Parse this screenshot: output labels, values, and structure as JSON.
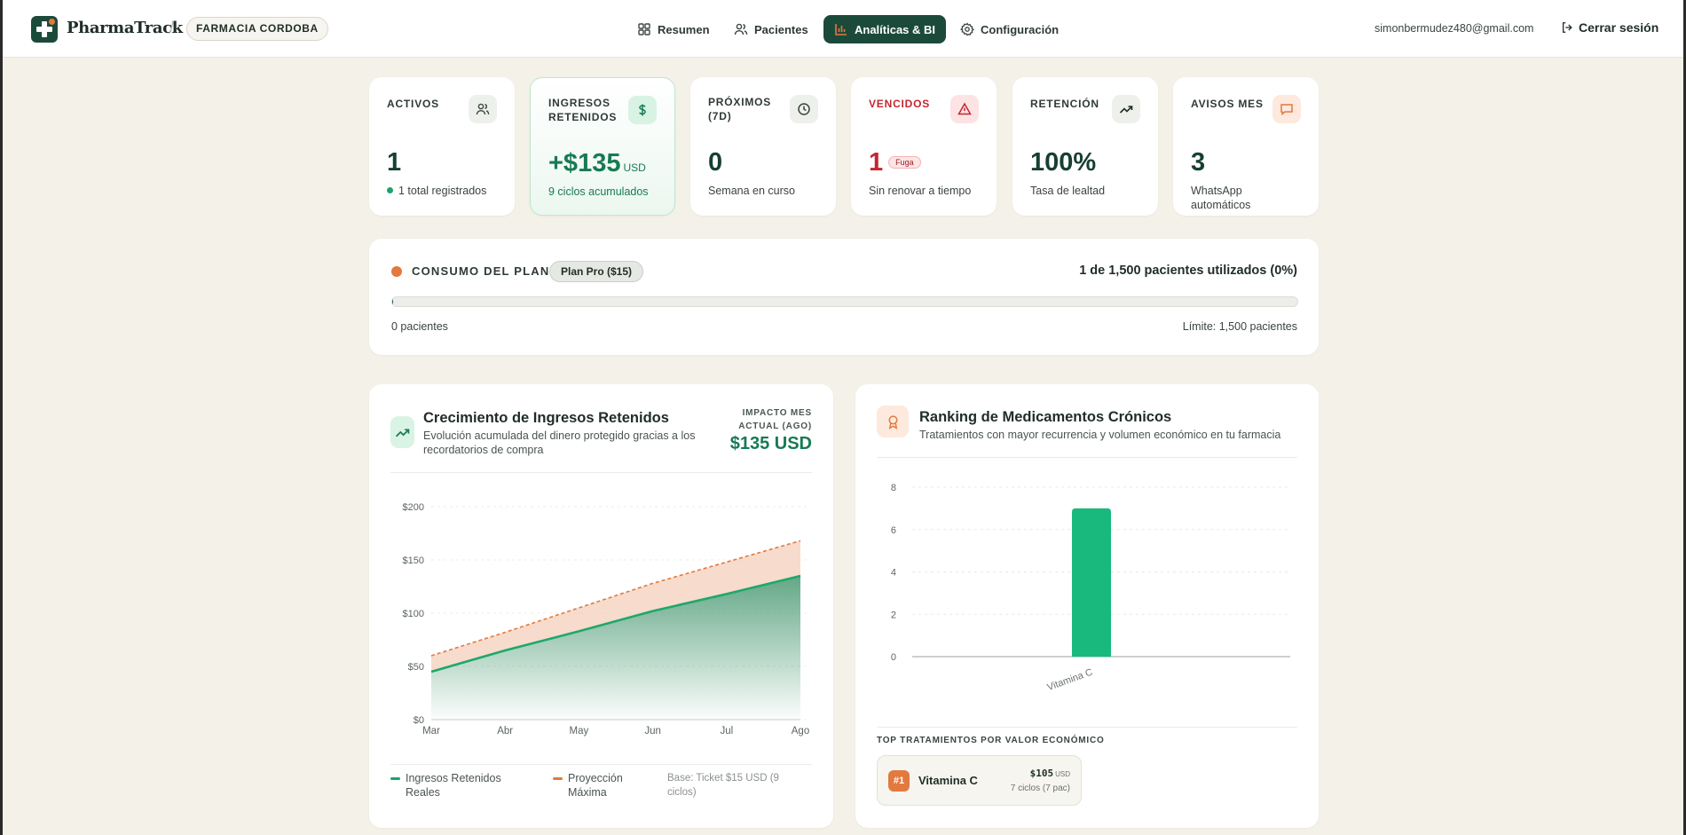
{
  "header": {
    "brand": "PharmaTrack",
    "separator": "/",
    "pharmacy": "FARMACIA CORDOBA",
    "nav": [
      {
        "label": "Resumen",
        "icon": "grid-icon"
      },
      {
        "label": "Pacientes",
        "icon": "users-icon"
      },
      {
        "label": "Analíticas & BI",
        "icon": "bar-chart-icon",
        "active": true
      },
      {
        "label": "Configuración",
        "icon": "gear-icon"
      }
    ],
    "email": "simonbermudez480@gmail.com",
    "logout": "Cerrar sesión"
  },
  "stats": [
    {
      "label": "ACTIVOS",
      "value": "1",
      "sub": "1 total registrados",
      "icon": "users-icon"
    },
    {
      "label": "INGRESOS RETENIDOS",
      "value": "+$135",
      "unit": "USD",
      "sub": "9 ciclos acumulados",
      "icon": "dollar-icon"
    },
    {
      "label": "PRÓXIMOS (7D)",
      "value": "0",
      "sub": "Semana en curso",
      "icon": "clock-icon"
    },
    {
      "label": "VENCIDOS",
      "value": "1",
      "badge": "Fuga",
      "sub": "Sin renovar a tiempo",
      "icon": "alert-triangle-icon"
    },
    {
      "label": "RETENCIÓN",
      "value": "100%",
      "sub": "Tasa de lealtad",
      "icon": "trending-up-icon"
    },
    {
      "label": "AVISOS MES",
      "value": "3",
      "sub": "WhatsApp automáticos",
      "icon": "message-icon"
    }
  ],
  "plan": {
    "title": "CONSUMO DEL PLAN",
    "chip": "Plan Pro ($15)",
    "usage": "1 de 1,500 pacientes utilizados (0%)",
    "progress": 0.0007,
    "low_label": "0 pacientes",
    "high_label": "Límite: 1,500 pacientes"
  },
  "growth": {
    "title": "Crecimiento de Ingresos Retenidos",
    "subtitle": "Evolución acumulada del dinero protegido gracias a los recordatorios de compra",
    "impact_label": "IMPACTO MES ACTUAL (AGO)",
    "impact_value": "$135 USD",
    "legend_real": "Ingresos Retenidos Reales",
    "legend_proj": "Proyección Máxima",
    "legend_base": "Base: Ticket $15 USD (9 ciclos)"
  },
  "ranking": {
    "title": "Ranking de Medicamentos Crónicos",
    "subtitle": "Tratamientos con mayor recurrencia y volumen económico en tu farmacia",
    "top_label": "TOP TRATAMIENTOS POR VALOR ECONÓMICO",
    "top": [
      {
        "rank": "#1",
        "name": "Vitamina C",
        "amount": "$105",
        "unit": "USD",
        "cycles": "7 ciclos (7 pac)"
      }
    ]
  },
  "colors": {
    "primary": "#1c4a3a",
    "accent": "#e2793f",
    "green": "#177a55",
    "bar": "#19b97d",
    "danger": "#c42630"
  },
  "chart_data": [
    {
      "type": "area",
      "categories": [
        "Mar",
        "Abr",
        "May",
        "Jun",
        "Jul",
        "Ago"
      ],
      "series": [
        {
          "name": "Ingresos Retenidos Reales",
          "values": [
            45,
            65,
            83,
            102,
            118,
            135
          ]
        },
        {
          "name": "Proyección Máxima",
          "values": [
            60,
            82,
            105,
            128,
            148,
            168
          ]
        }
      ],
      "ylim": [
        0,
        200
      ],
      "yticks": [
        "$0",
        "$50",
        "$100",
        "$150",
        "$200"
      ],
      "ytick_values": [
        0,
        50,
        100,
        150,
        200
      ],
      "grid": true
    },
    {
      "type": "bar",
      "categories": [
        "Vitamina C"
      ],
      "values": [
        7
      ],
      "ylim": [
        0,
        8
      ],
      "yticks": [
        "0",
        "2",
        "4",
        "6",
        "8"
      ],
      "ytick_values": [
        0,
        2,
        4,
        6,
        8
      ],
      "grid": true
    }
  ]
}
